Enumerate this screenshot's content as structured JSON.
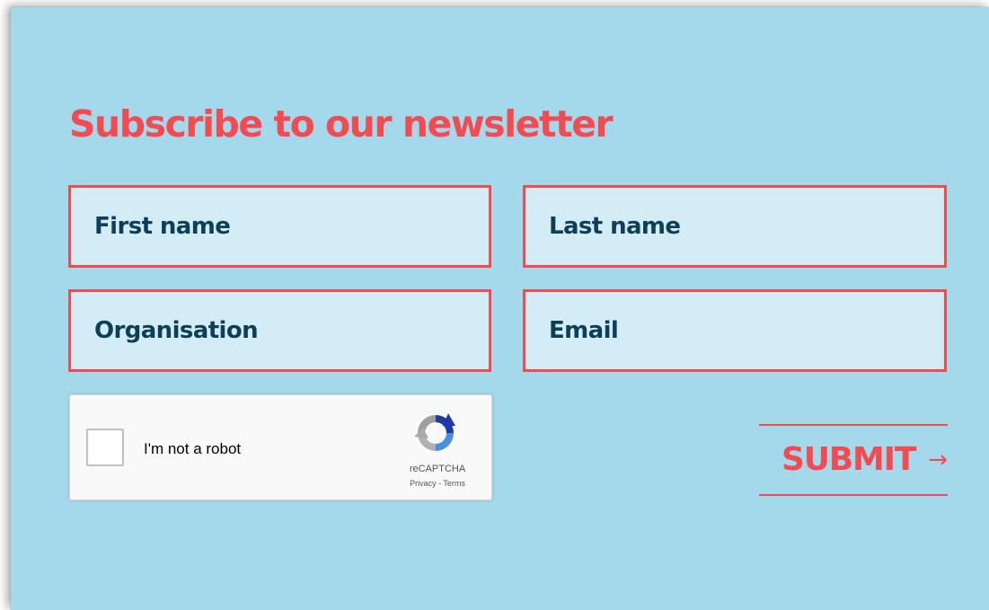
{
  "form": {
    "title": "Subscribe to our newsletter",
    "fields": {
      "first_name": {
        "placeholder": "First name",
        "value": ""
      },
      "last_name": {
        "placeholder": "Last name",
        "value": ""
      },
      "organisation": {
        "placeholder": "Organisation",
        "value": ""
      },
      "email": {
        "placeholder": "Email",
        "value": ""
      }
    },
    "submit_label": "SUBMIT",
    "submit_arrow": "→"
  },
  "recaptcha": {
    "label": "I'm not a robot",
    "brand": "reCAPTCHA",
    "privacy": "Privacy",
    "separator": " - ",
    "terms": "Terms",
    "checked": false
  },
  "colors": {
    "panel_background": "#a4d8eb",
    "field_background": "#d3ecf5",
    "accent_red": "#f24b52",
    "field_text": "#0d3f5a"
  },
  "icons": {
    "recaptcha_logo": "recaptcha-logo-icon",
    "submit_arrow": "arrow-right-icon"
  }
}
